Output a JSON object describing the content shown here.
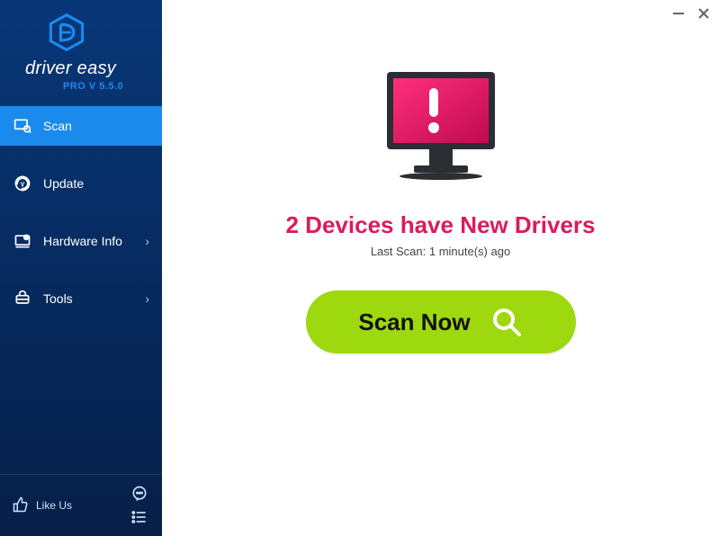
{
  "brand": {
    "name": "driver easy",
    "version": "PRO V 5.5.0"
  },
  "sidebar": {
    "items": [
      {
        "label": "Scan",
        "active": true,
        "hasChevron": false,
        "name": "scan"
      },
      {
        "label": "Update",
        "active": false,
        "hasChevron": false,
        "name": "update"
      },
      {
        "label": "Hardware Info",
        "active": false,
        "hasChevron": true,
        "name": "hardware-info"
      },
      {
        "label": "Tools",
        "active": false,
        "hasChevron": true,
        "name": "tools"
      }
    ],
    "like_label": "Like Us"
  },
  "main": {
    "headline": "2 Devices have New Drivers",
    "last_scan": "Last Scan: 1 minute(s) ago",
    "scan_button": "Scan Now"
  },
  "colors": {
    "accent_pink": "#da1c5c",
    "accent_green": "#9ed80e",
    "brand_blue": "#1a8bed"
  }
}
